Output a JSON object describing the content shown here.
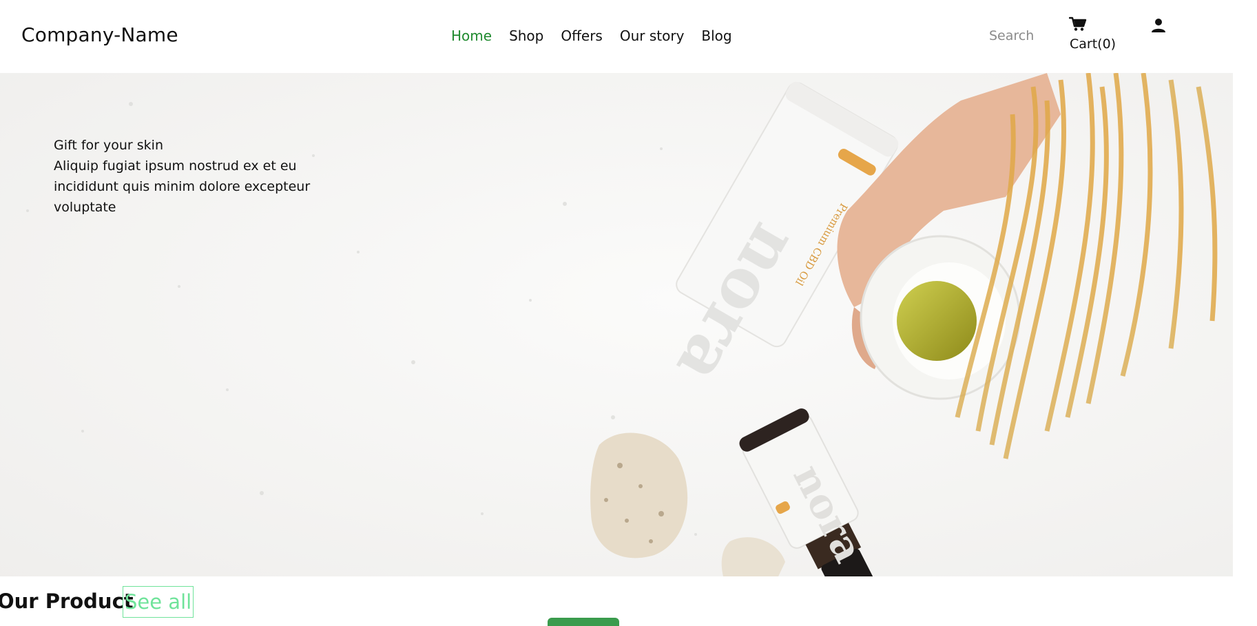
{
  "header": {
    "logo": "Company-Name",
    "nav": [
      {
        "label": "Home",
        "active": true
      },
      {
        "label": "Shop",
        "active": false
      },
      {
        "label": "Offers",
        "active": false
      },
      {
        "label": "Our story",
        "active": false
      },
      {
        "label": "Blog",
        "active": false
      }
    ],
    "search_placeholder": "Search",
    "cart_label": "Cart(0)",
    "icons": {
      "cart": "cart-icon",
      "user": "user-icon"
    }
  },
  "hero": {
    "title": "Gift for your skin",
    "body": "Aliquip fugiat ipsum nostrud ex et eu incididunt quis minim dolore excepteur voluptate",
    "image_desc_icon": "hero-image"
  },
  "products": {
    "title": "Our Product",
    "see_all": "See all"
  },
  "colors": {
    "active_nav": "#1f8a2e",
    "see_all": "#6fe39a",
    "green_tab": "#3a9b4d"
  }
}
